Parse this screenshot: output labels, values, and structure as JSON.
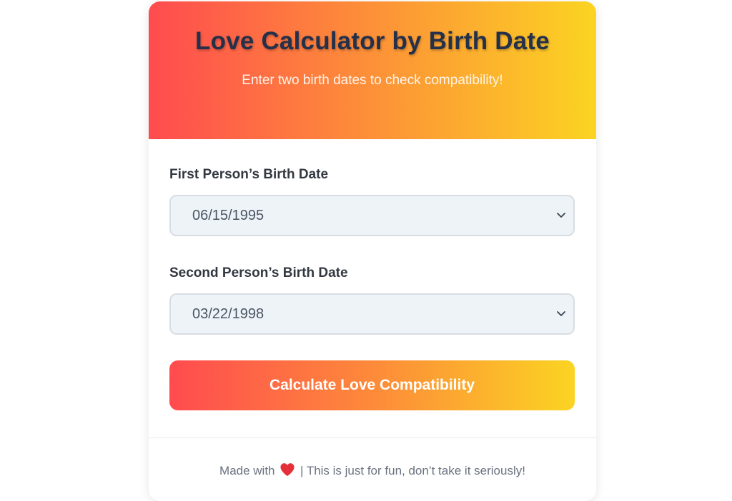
{
  "header": {
    "title": "Love Calculator by Birth Date",
    "subtitle": "Enter two birth dates to check compatibility!"
  },
  "form": {
    "first": {
      "label": "First Person’s Birth Date",
      "value": "06/15/1995"
    },
    "second": {
      "label": "Second Person’s Birth Date",
      "value": "03/22/1998"
    },
    "button_label": "Calculate Love Compatibility"
  },
  "footer": {
    "made_with": "Made with",
    "rest": "| This is just for fun, don’t take it seriously!"
  },
  "icons": {
    "heart": "heart-icon",
    "chevron": "chevron-down-icon"
  },
  "colors": {
    "gradient_start": "#ff4b4f",
    "gradient_mid": "#fd8a3a",
    "gradient_end": "#fbd422",
    "heart": "#e5303a"
  }
}
